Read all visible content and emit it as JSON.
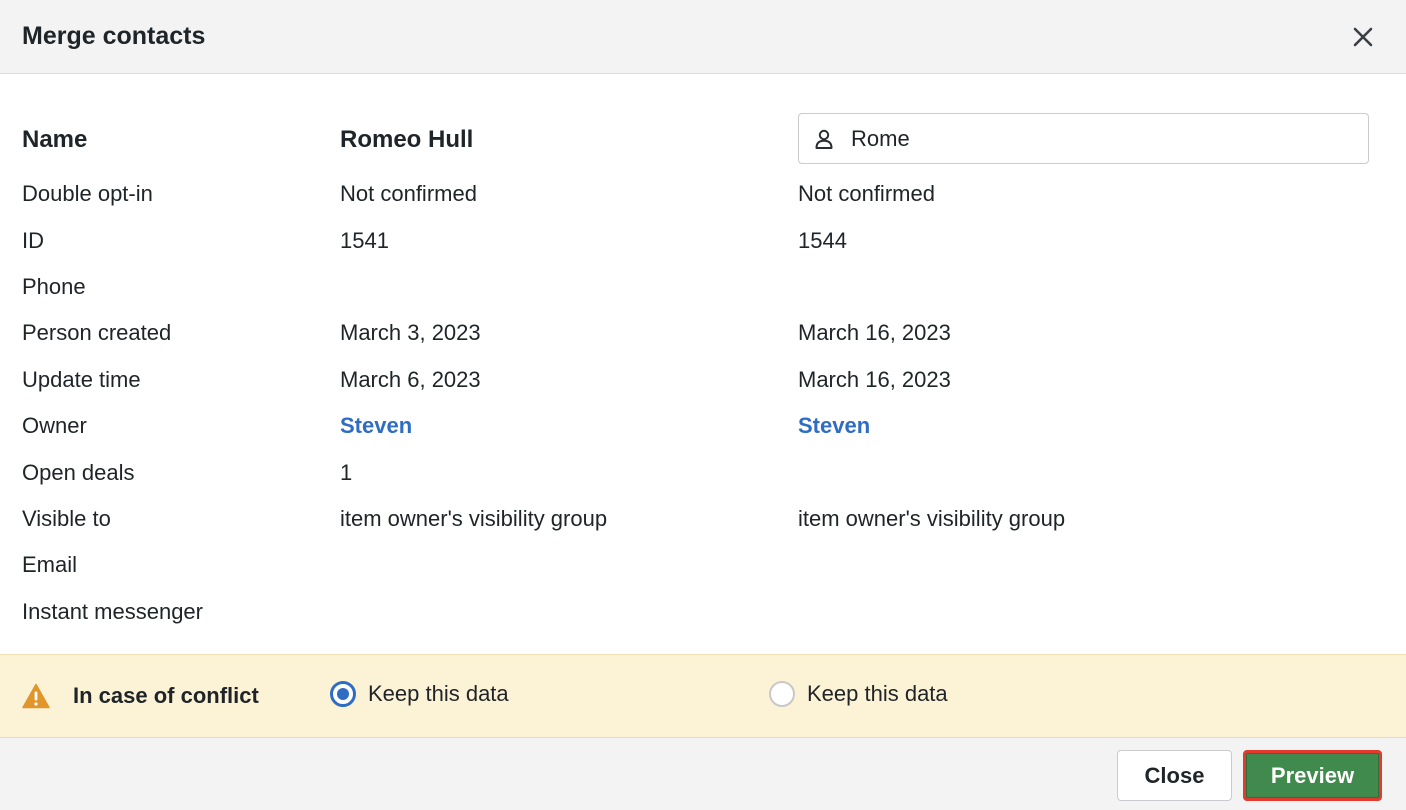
{
  "header": {
    "title": "Merge contacts",
    "close_icon": "close-icon"
  },
  "name_row": {
    "label": "Name",
    "left_value": "Romeo Hull",
    "right_input_value": "Rome",
    "right_input_icon": "person-icon"
  },
  "rows": [
    {
      "label": "Double opt-in",
      "left": "Not confirmed",
      "right": "Not confirmed"
    },
    {
      "label": "ID",
      "left": "1541",
      "right": "1544"
    },
    {
      "label": "Phone",
      "left": "",
      "right": ""
    },
    {
      "label": "Person created",
      "left": "March 3, 2023",
      "right": "March 16, 2023"
    },
    {
      "label": "Update time",
      "left": "March 6, 2023",
      "right": "March 16, 2023"
    },
    {
      "label": "Owner",
      "left": "Steven",
      "right": "Steven"
    },
    {
      "label": "Open deals",
      "left": "1",
      "right": ""
    },
    {
      "label": "Visible to",
      "left": "item owner's visibility group",
      "right": "item owner's visibility group"
    },
    {
      "label": "Email",
      "left": "",
      "right": ""
    },
    {
      "label": "Instant messenger",
      "left": "",
      "right": ""
    }
  ],
  "conflict": {
    "icon": "warning-icon",
    "label": "In case of conflict",
    "option_left": "Keep this data",
    "option_right": "Keep this data",
    "selected": "left"
  },
  "footer": {
    "close_label": "Close",
    "preview_label": "Preview"
  },
  "colors": {
    "link": "#2f6cc4",
    "preview_bg": "#3f8a4c",
    "highlight_border": "#e03b2e",
    "conflict_bg": "#fcf3d7"
  }
}
